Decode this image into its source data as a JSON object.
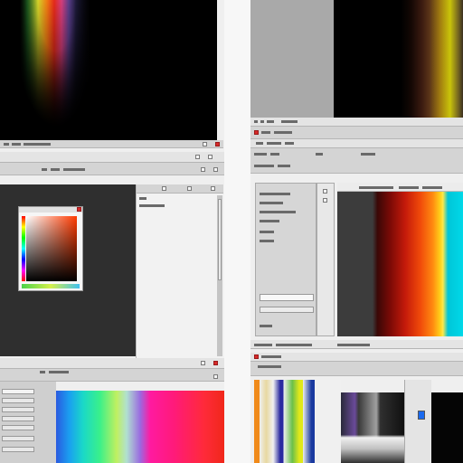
{
  "panels": [
    {
      "id": "top-left",
      "label": "",
      "toolbar": [],
      "menu": []
    },
    {
      "id": "top-right",
      "label": "",
      "toolbar": [],
      "menu": []
    },
    {
      "id": "middle-left",
      "label": "",
      "toolbar": [],
      "menu": []
    },
    {
      "id": "middle-right",
      "label": "",
      "toolbar": [],
      "menu": []
    },
    {
      "id": "bottom-left",
      "label": "",
      "toolbar": [],
      "menu": []
    },
    {
      "id": "bottom-right",
      "label": "",
      "toolbar": [],
      "menu": []
    }
  ],
  "colors": {
    "background": "#efefef",
    "toolbar": "#d4d4d4",
    "canvas_dark": "#2f2f2f",
    "sidebar_gray": "#a9a9a9",
    "close_red": "#d62a2a",
    "scroll_track": "#c4c4c4"
  },
  "icons": [
    "window-close-icon",
    "window-maximize-icon",
    "window-minimize-icon",
    "color-picker-icon",
    "scroll-thumb-icon"
  ]
}
